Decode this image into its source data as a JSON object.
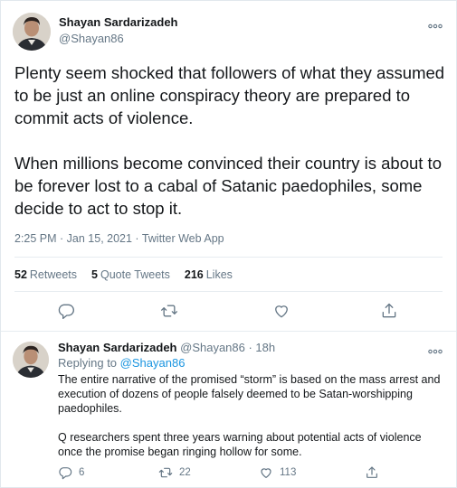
{
  "tweet": {
    "author_name": "Shayan Sardarizadeh",
    "author_handle": "@Shayan86",
    "paragraphs": [
      "Plenty seem shocked that followers of what they assumed to be just an online conspiracy theory are prepared to commit acts of violence.",
      "When millions become convinced their country is about to be forever lost to a cabal of Satanic paedophiles, some decide to act to stop it."
    ],
    "meta": "2:25 PM · Jan 15, 2021 · Twitter Web App",
    "stats": {
      "retweets_count": "52",
      "retweets_label": "Retweets",
      "quotes_count": "5",
      "quotes_label": "Quote Tweets",
      "likes_count": "216",
      "likes_label": "Likes"
    }
  },
  "reply": {
    "author_name": "Shayan Sardarizadeh",
    "author_handle_time": "@Shayan86 · 18h",
    "replying_prefix": "Replying to",
    "replying_to": "@Shayan86",
    "paragraphs": [
      "The entire narrative of the promised “storm” is based on the mass arrest and execution of dozens of people falsely deemed to be Satan-worshipping paedophiles.",
      "Q researchers spent three years warning about potential acts of violence once the promise began ringing hollow for some."
    ],
    "reply_count": "6",
    "retweet_count": "22",
    "like_count": "113"
  },
  "icons": {
    "more": "more-icon",
    "reply": "reply-icon",
    "retweet": "retweet-icon",
    "like": "like-icon",
    "share": "share-icon"
  },
  "colors": {
    "text": "#14171a",
    "secondary": "#657786",
    "link": "#1b95e0",
    "border": "#e6ecf0"
  }
}
